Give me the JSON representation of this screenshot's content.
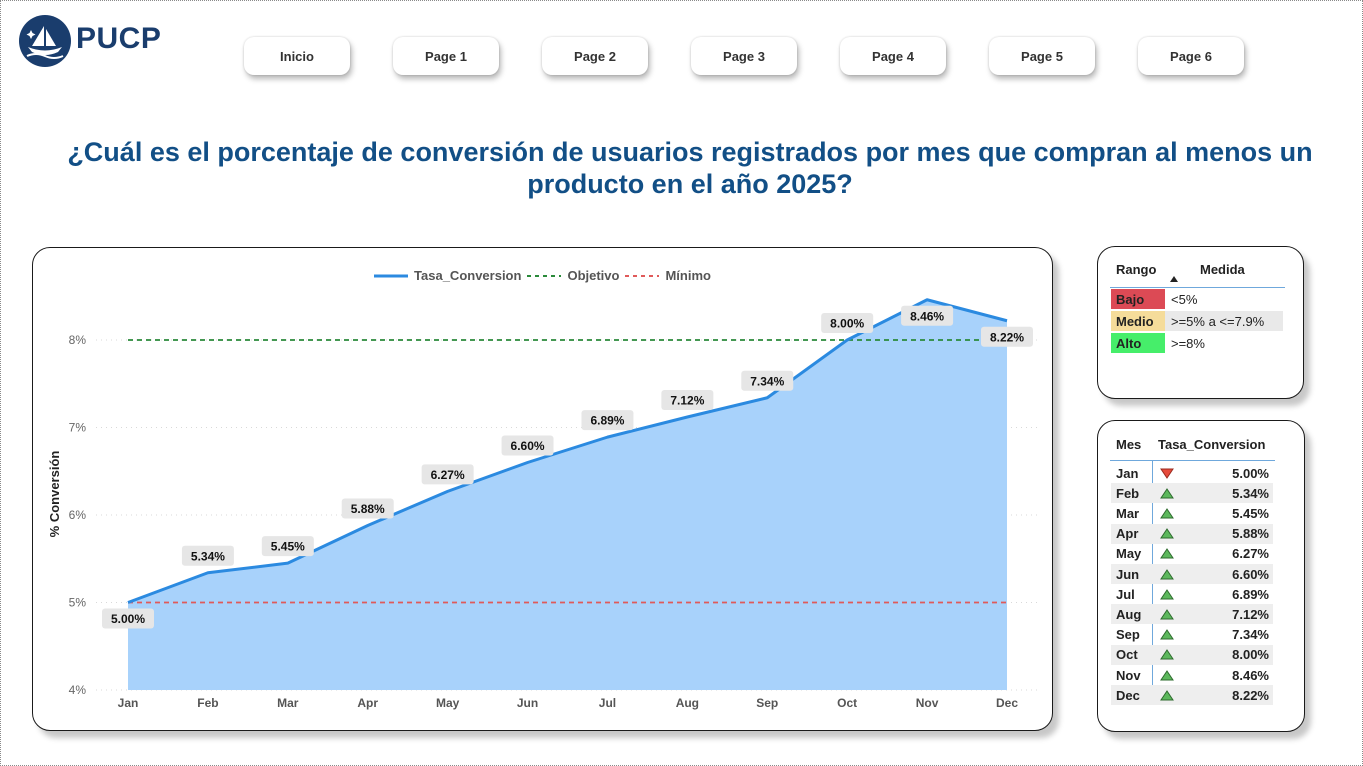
{
  "brand": {
    "name": "PUCP"
  },
  "nav": {
    "items": [
      "Inicio",
      "Page 1",
      "Page 2",
      "Page 3",
      "Page 4",
      "Page 5",
      "Page 6"
    ]
  },
  "page": {
    "title": "¿Cuál es el porcentaje de conversión de usuarios registrados por mes que compran al menos un producto en el año 2025?"
  },
  "chart_data": {
    "type": "area",
    "categories": [
      "Jan",
      "Feb",
      "Mar",
      "Apr",
      "May",
      "Jun",
      "Jul",
      "Aug",
      "Sep",
      "Oct",
      "Nov",
      "Dec"
    ],
    "series": [
      {
        "name": "Tasa_Conversion",
        "values": [
          5.0,
          5.34,
          5.45,
          5.88,
          6.27,
          6.6,
          6.89,
          7.12,
          7.34,
          8.0,
          8.46,
          8.22
        ],
        "color": "#2b8ae0",
        "fill": "#a8d2fb"
      }
    ],
    "reference_lines": [
      {
        "name": "Objetivo",
        "value": 8,
        "color": "#2a8a3a",
        "style": "dashed"
      },
      {
        "name": "Mínimo",
        "value": 5,
        "color": "#e05a5a",
        "style": "dashed"
      }
    ],
    "data_labels": [
      "5.00%",
      "5.34%",
      "5.45%",
      "5.88%",
      "6.27%",
      "6.60%",
      "6.89%",
      "7.12%",
      "7.34%",
      "8.00%",
      "8.46%",
      "8.22%"
    ],
    "ylabel": "% Conversión",
    "ylim": [
      4,
      8.6
    ],
    "yticks": [
      4,
      5,
      6,
      7,
      8
    ],
    "ytick_labels": [
      "4%",
      "5%",
      "6%",
      "7%",
      "8%"
    ],
    "grid": true,
    "legend_position": "top-center"
  },
  "range_table": {
    "headers": [
      "Rango",
      "Medida"
    ],
    "rows": [
      {
        "label": "Bajo",
        "value": "<5%",
        "color": "#dc4a55"
      },
      {
        "label": "Medio",
        "value": ">=5% a <=7.9%",
        "color": "#f5dc9a"
      },
      {
        "label": "Alto",
        "value": ">=8%",
        "color": "#46ee6a"
      }
    ]
  },
  "month_table": {
    "headers": [
      "Mes",
      "Tasa_Conversion"
    ],
    "rows": [
      {
        "month": "Jan",
        "value": "5.00%",
        "trend": "down"
      },
      {
        "month": "Feb",
        "value": "5.34%",
        "trend": "up"
      },
      {
        "month": "Mar",
        "value": "5.45%",
        "trend": "up"
      },
      {
        "month": "Apr",
        "value": "5.88%",
        "trend": "up"
      },
      {
        "month": "May",
        "value": "6.27%",
        "trend": "up"
      },
      {
        "month": "Jun",
        "value": "6.60%",
        "trend": "up"
      },
      {
        "month": "Jul",
        "value": "6.89%",
        "trend": "up"
      },
      {
        "month": "Aug",
        "value": "7.12%",
        "trend": "up"
      },
      {
        "month": "Sep",
        "value": "7.34%",
        "trend": "up"
      },
      {
        "month": "Oct",
        "value": "8.00%",
        "trend": "up"
      },
      {
        "month": "Nov",
        "value": "8.46%",
        "trend": "up"
      },
      {
        "month": "Dec",
        "value": "8.22%",
        "trend": "up"
      }
    ]
  }
}
